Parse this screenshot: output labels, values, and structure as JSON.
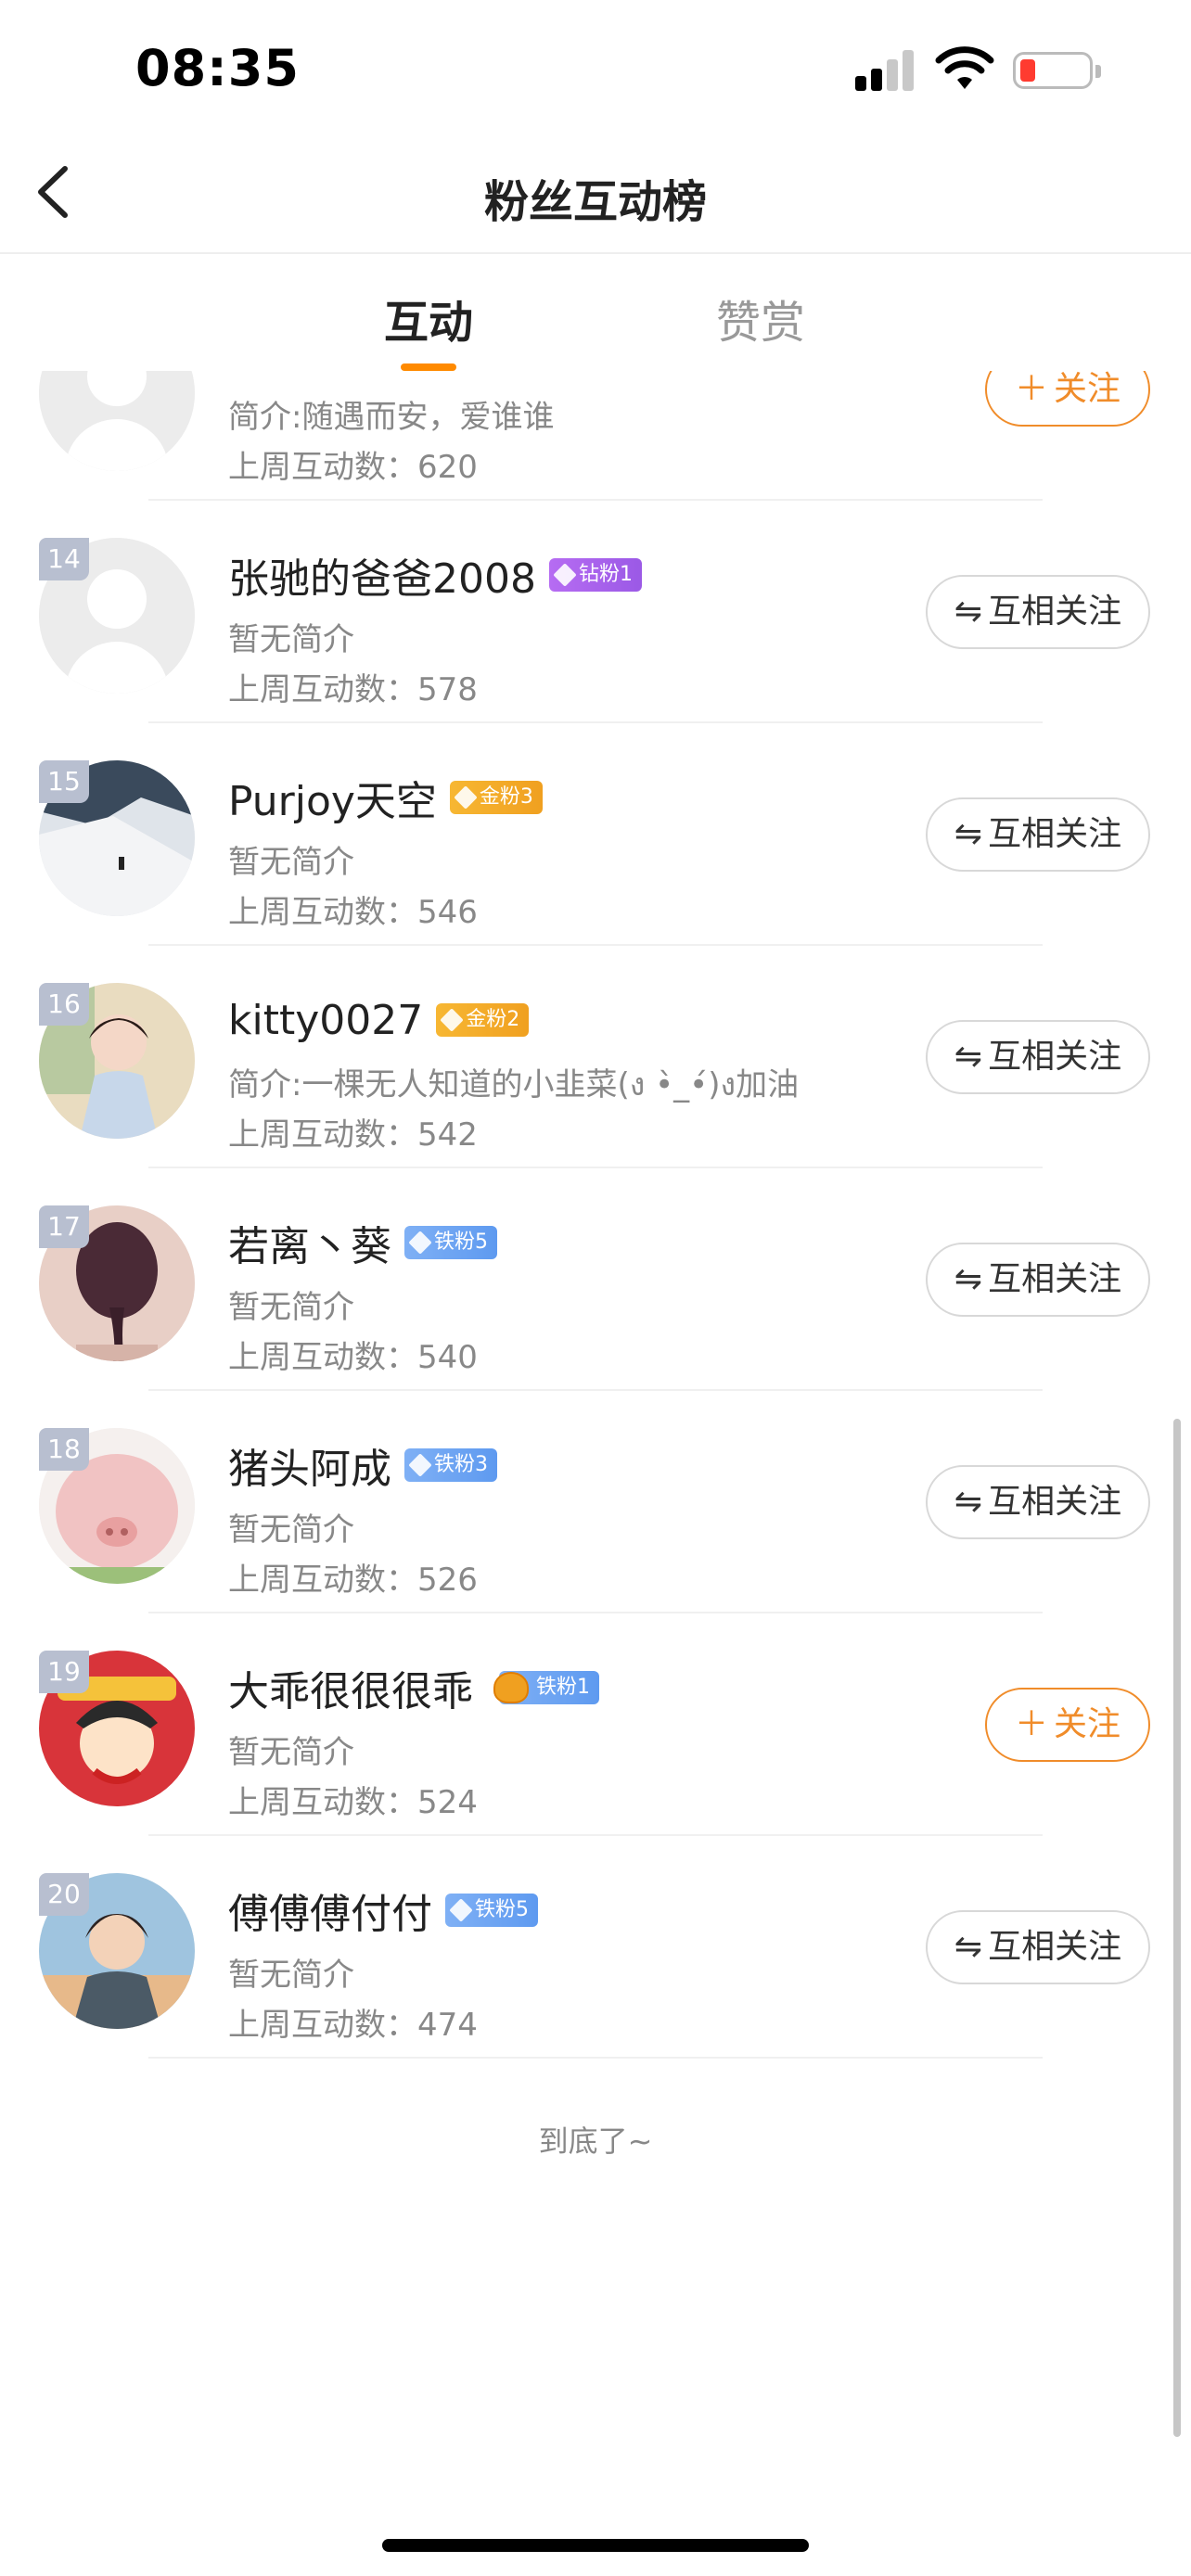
{
  "status_bar": {
    "time": "08:35",
    "battery_color": "#ff3b30"
  },
  "header": {
    "title": "粉丝互动榜",
    "back_icon": "chevron-left-icon"
  },
  "tabs": [
    {
      "label": "互动",
      "active": true
    },
    {
      "label": "赞赏",
      "active": false
    }
  ],
  "buttons": {
    "mutual_label": "互相关注",
    "follow_label": "关注"
  },
  "list": [
    {
      "rank": "",
      "name": "",
      "badge": "",
      "intro": "简介:随遇而安，爱谁谁",
      "stat": "上周互动数：620",
      "button": "follow"
    },
    {
      "rank": "14",
      "name": "张驰的爸爸2008",
      "badge": "钻粉1",
      "badge_color": "#a660ee",
      "intro": "暂无简介",
      "stat": "上周互动数：578",
      "button": "mutual"
    },
    {
      "rank": "15",
      "name": "Purjoy天空",
      "badge": "金粉3",
      "badge_color": "#f4ad2a",
      "intro": "暂无简介",
      "stat": "上周互动数：546",
      "button": "mutual"
    },
    {
      "rank": "16",
      "name": "kitty0027",
      "badge": "金粉2",
      "badge_color": "#f4ad2a",
      "intro": "简介:一棵无人知道的小韭菜(ง •̀_•́)ง加油",
      "stat": "上周互动数：542",
      "button": "mutual"
    },
    {
      "rank": "17",
      "name": "若离丶葵",
      "badge": "铁粉5",
      "badge_color": "#6aa3f2",
      "intro": "暂无简介",
      "stat": "上周互动数：540",
      "button": "mutual"
    },
    {
      "rank": "18",
      "name": "猪头阿成",
      "badge": "铁粉3",
      "badge_color": "#6aa3f2",
      "intro": "暂无简介",
      "stat": "上周互动数：526",
      "button": "mutual"
    },
    {
      "rank": "19",
      "name": "大乖很很很乖",
      "badge": "铁粉1",
      "badge_color": "#6aa3f2",
      "intro": "暂无简介",
      "stat": "上周互动数：524",
      "button": "follow"
    },
    {
      "rank": "20",
      "name": "傅傅傅付付",
      "badge": "铁粉5",
      "badge_color": "#6aa3f2",
      "intro": "暂无简介",
      "stat": "上周互动数：474",
      "button": "mutual"
    }
  ],
  "footer": {
    "end_text": "到底了~"
  },
  "colors": {
    "accent": "#ff8a00",
    "follow": "#f08c2a"
  }
}
